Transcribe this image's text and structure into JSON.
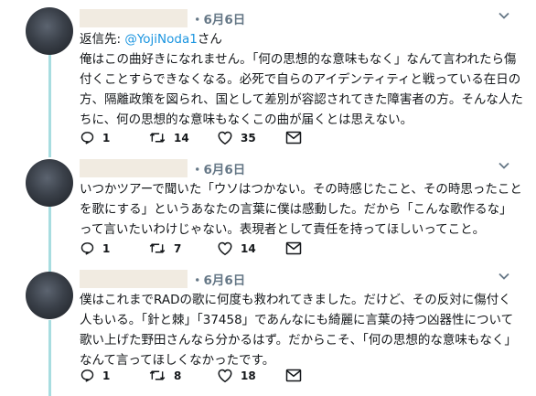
{
  "tweets": [
    {
      "date": "・6月6日",
      "reply_prefix": "返信先: ",
      "reply_handle": "@YojiNoda1",
      "reply_suffix": "さん",
      "text": "俺はこの曲好きになれません。「何の思想的な意味もなく」なんて言われたら傷付くことすらできなくなる。必死で自らのアイデンティティと戦っている在日の方、隔離政策を図られ、国として差別が容認されてきた障害者の方。そんな人たちに、何の思想的な意味もなくこの曲が届くとは思えない。",
      "replies": "1",
      "retweets": "14",
      "likes": "35"
    },
    {
      "date": "・6月6日",
      "text": "いつかツアーで聞いた「ウソはつかない。その時感じたこと、その時思ったことを歌にする」というあなたの言葉に僕は感動した。だから「こんな歌作るな」って言いたいわけじゃない。表現者として責任を持ってほしいってこと。",
      "replies": "1",
      "retweets": "7",
      "likes": "14"
    },
    {
      "date": "・6月6日",
      "text": "僕はこれまでRADの歌に何度も救われてきました。だけど、その反対に傷付く人もいる。「針と棘」「37458」であんなにも綺麗に言葉の持つ凶器性について歌い上げた野田さんなら分かるはず。だからこそ、「何の思想的な意味もなく」なんて言ってほしくなかったです。",
      "replies": "1",
      "retweets": "8",
      "likes": "18"
    }
  ],
  "icons": {
    "reply": "reply-icon",
    "retweet": "retweet-icon",
    "like": "heart-icon",
    "message": "envelope-icon",
    "menu": "chevron-down-icon"
  },
  "colors": {
    "thread_line": "#a8dde0",
    "handle": "#1b95e0",
    "muted": "#657786"
  }
}
